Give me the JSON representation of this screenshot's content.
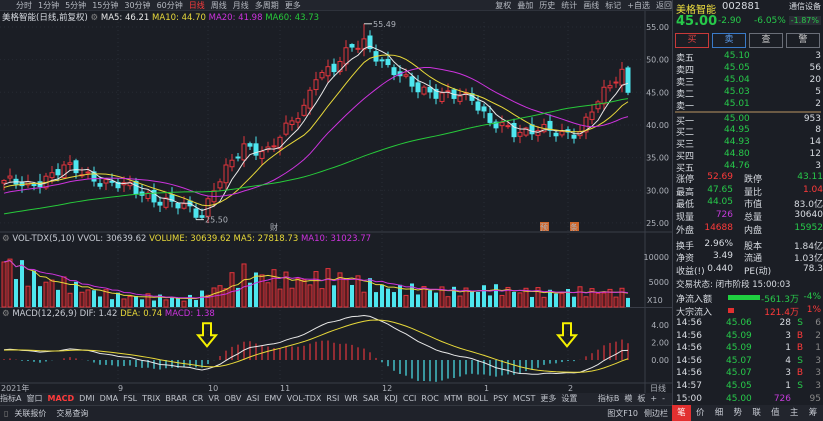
{
  "toolbar": {
    "periods": [
      "分时",
      "1分钟",
      "5分钟",
      "15分钟",
      "30分钟",
      "60分钟",
      "日线",
      "周线",
      "月线",
      "多周期",
      "更多"
    ],
    "active": "日线",
    "actions": [
      "复权",
      "叠加",
      "历史",
      "统计",
      "画线",
      "标记",
      "+自选",
      "返回"
    ]
  },
  "title": {
    "name": "美格智能(日线,前复权)",
    "ma5": "MA5: 46.21",
    "ma10": "MA10: 44.70",
    "ma20": "MA20: 41.98",
    "ma60": "MA60: 43.73"
  },
  "vol_title": {
    "name": "VOL-TDX(5,10)",
    "vvol": "VVOL: 30639.62",
    "volume": "VOLUME: 30639.62",
    "ma5": "MA5: 27818.73",
    "ma10": "MA10: 31023.77"
  },
  "macd_title": {
    "name": "MACD(12,26,9)",
    "dif": "DIF: 1.42",
    "dea": "DEA: 0.74",
    "macd": "MACD: 1.38"
  },
  "colors": {
    "up": "#e0353d",
    "down": "#4ee6ef",
    "ma5": "#e8e8e8",
    "ma10": "#e8d93a",
    "ma20": "#cc33dd",
    "ma60": "#27c93a",
    "arrow": "#f5f000"
  },
  "chart_data": {
    "type": "candlestick",
    "price_axis": [
      "55.00",
      "50.00",
      "45.00",
      "40.00",
      "35.00",
      "30.00",
      "25.00"
    ],
    "price_axis_values": [
      55,
      50,
      45,
      40,
      35,
      30,
      25
    ],
    "vol_axis": [
      "10000",
      "5000"
    ],
    "vol_axis_values": [
      10000,
      5000
    ],
    "vol_unit": "X10",
    "macd_axis": [
      "4.00",
      "2.00",
      "0.00"
    ],
    "macd_axis_values": [
      4,
      2,
      0
    ],
    "months": [
      {
        "label": "2021年",
        "bar": 0
      },
      {
        "label": "9",
        "bar": 19
      },
      {
        "label": "10",
        "bar": 34
      },
      {
        "label": "11",
        "bar": 46
      },
      {
        "label": "12",
        "bar": 63
      },
      {
        "label": "1",
        "bar": 80
      },
      {
        "label": "2",
        "bar": 94
      }
    ],
    "period_label": "日线",
    "bars": 105,
    "close_keypoints": [
      [
        -60,
        22
      ],
      [
        -30,
        26
      ],
      [
        -1,
        31
      ],
      [
        0,
        31.5
      ],
      [
        4,
        30.5
      ],
      [
        8,
        32.6
      ],
      [
        10,
        33.5
      ],
      [
        16,
        31.6
      ],
      [
        21,
        30.3
      ],
      [
        26,
        28.5
      ],
      [
        31,
        27
      ],
      [
        33,
        26.3
      ],
      [
        35,
        30.5
      ],
      [
        40,
        36.6
      ],
      [
        44,
        36.2
      ],
      [
        47,
        39.2
      ],
      [
        50,
        42.7
      ],
      [
        52,
        48
      ],
      [
        55,
        48.4
      ],
      [
        58,
        52
      ],
      [
        60,
        53
      ],
      [
        64,
        48.4
      ],
      [
        68,
        46.4
      ],
      [
        73,
        44.3
      ],
      [
        78,
        44.5
      ],
      [
        81,
        40.3
      ],
      [
        85,
        38.8
      ],
      [
        89,
        39.7
      ],
      [
        93,
        38.2
      ],
      [
        96,
        39.2
      ],
      [
        98,
        42.7
      ],
      [
        101,
        45.8
      ],
      [
        103,
        47.9
      ],
      [
        104,
        45.0
      ]
    ],
    "volume_keypoints": [
      [
        0,
        9000
      ],
      [
        3,
        7000
      ],
      [
        6,
        5000
      ],
      [
        10,
        4500
      ],
      [
        15,
        3000
      ],
      [
        20,
        2000
      ],
      [
        25,
        2000
      ],
      [
        30,
        1500
      ],
      [
        33,
        2500
      ],
      [
        36,
        4000
      ],
      [
        40,
        6500
      ],
      [
        44,
        6000
      ],
      [
        48,
        5000
      ],
      [
        52,
        5500
      ],
      [
        56,
        6000
      ],
      [
        60,
        4500
      ],
      [
        65,
        3500
      ],
      [
        70,
        3500
      ],
      [
        75,
        3000
      ],
      [
        80,
        3500
      ],
      [
        85,
        3200
      ],
      [
        90,
        2800
      ],
      [
        95,
        3000
      ],
      [
        100,
        3000
      ],
      [
        104,
        2700
      ]
    ],
    "high_label": "55.49",
    "high_bar": 60,
    "low_label": "25.50",
    "low_bar": 32,
    "markers": [
      {
        "label": "财",
        "bar": 45
      },
      {
        "label": "预",
        "bar": 90
      },
      {
        "label": "条",
        "bar": 95
      }
    ],
    "signal_arrows": [
      34,
      94
    ]
  },
  "quote": {
    "name": "美格智能",
    "code": "002881",
    "sector": "通信设备",
    "price": "45.00",
    "change": "-2.90",
    "pct": "-6.05%",
    "sector_pct": "-1.87%",
    "buttons": [
      "买",
      "卖",
      "查",
      "警"
    ]
  },
  "orderbook": [
    {
      "label": "卖五",
      "price": "45.10",
      "vol": "3"
    },
    {
      "label": "卖四",
      "price": "45.05",
      "vol": "56"
    },
    {
      "label": "卖三",
      "price": "45.04",
      "vol": "20"
    },
    {
      "label": "卖二",
      "price": "45.03",
      "vol": "5"
    },
    {
      "label": "卖一",
      "price": "45.01",
      "vol": "2"
    },
    {
      "label": "买一",
      "price": "45.00",
      "vol": "953"
    },
    {
      "label": "买二",
      "price": "44.95",
      "vol": "8"
    },
    {
      "label": "买三",
      "price": "44.93",
      "vol": "14"
    },
    {
      "label": "买四",
      "price": "44.80",
      "vol": "12"
    },
    {
      "label": "买五",
      "price": "44.76",
      "vol": "3"
    }
  ],
  "stats": [
    {
      "k1": "涨停",
      "v1": "52.69",
      "c1": "r",
      "k2": "跌停",
      "v2": "43.11",
      "c2": "g"
    },
    {
      "k1": "最高",
      "v1": "47.65",
      "c1": "g",
      "k2": "量比",
      "v2": "1.04",
      "c2": "r"
    },
    {
      "k1": "最低",
      "v1": "44.05",
      "c1": "g",
      "k2": "市值",
      "v2": "83.0亿",
      "c2": "w"
    },
    {
      "k1": "现量",
      "v1": "726",
      "c1": "m",
      "k2": "总量",
      "v2": "30640",
      "c2": "w"
    },
    {
      "k1": "外盘",
      "v1": "14688",
      "c1": "r",
      "k2": "内盘",
      "v2": "15952",
      "c2": "g"
    },
    {
      "k1": "换手",
      "v1": "2.96%",
      "c1": "w",
      "k2": "股本",
      "v2": "1.84亿",
      "c2": "w"
    },
    {
      "k1": "净资",
      "v1": "3.49",
      "c1": "w",
      "k2": "流通",
      "v2": "1.03亿",
      "c2": "w"
    },
    {
      "k1": "收益(!)",
      "v1": "0.440",
      "c1": "w",
      "k2": "PE(动)",
      "v2": "78.3",
      "c2": "w"
    }
  ],
  "trade_status": "交易状态: 闭市阶段 15:00:03",
  "flows": [
    {
      "label": "净流入额",
      "value": "-561.3万",
      "pct": "-4%",
      "color": "g",
      "bar": 0.9
    },
    {
      "label": "大宗流入",
      "value": "121.4万",
      "pct": "1%",
      "color": "r",
      "bar": 0.1
    }
  ],
  "ticks": [
    {
      "t": "14:56",
      "p": "45.06",
      "v": "28",
      "s": "S",
      "n": "6"
    },
    {
      "t": "14:56",
      "p": "45.09",
      "v": "3",
      "s": "B",
      "n": "2"
    },
    {
      "t": "14:56",
      "p": "45.09",
      "v": "1",
      "s": "B",
      "n": "1"
    },
    {
      "t": "14:56",
      "p": "45.07",
      "v": "4",
      "s": "S",
      "n": "3"
    },
    {
      "t": "14:56",
      "p": "45.07",
      "v": "3",
      "s": "B",
      "n": "3"
    },
    {
      "t": "14:57",
      "p": "45.05",
      "v": "1",
      "s": "S",
      "n": "3"
    },
    {
      "t": "15:00",
      "p": "45.00",
      "v": "726",
      "s": "",
      "n": "95"
    }
  ],
  "right_tabs": [
    "笔",
    "价",
    "细",
    "势",
    "联",
    "值",
    "主",
    "筹"
  ],
  "indicators": [
    "指标A",
    "窗口",
    "MACD",
    "DMI",
    "DMA",
    "FSL",
    "TRIX",
    "BRAR",
    "CR",
    "VR",
    "OBV",
    "ASI",
    "EMV",
    "VOL-TDX",
    "RSI",
    "WR",
    "SAR",
    "KDJ",
    "CCI",
    "ROC",
    "MTM",
    "BOLL",
    "PSY",
    "MCST",
    "更多",
    "设置"
  ],
  "indicators_right": [
    "指标B",
    "模",
    "板",
    "+",
    "-"
  ],
  "status": {
    "left": [
      "关联报价",
      "交易查询"
    ],
    "right": [
      "图文F10",
      "侧边栏"
    ]
  }
}
